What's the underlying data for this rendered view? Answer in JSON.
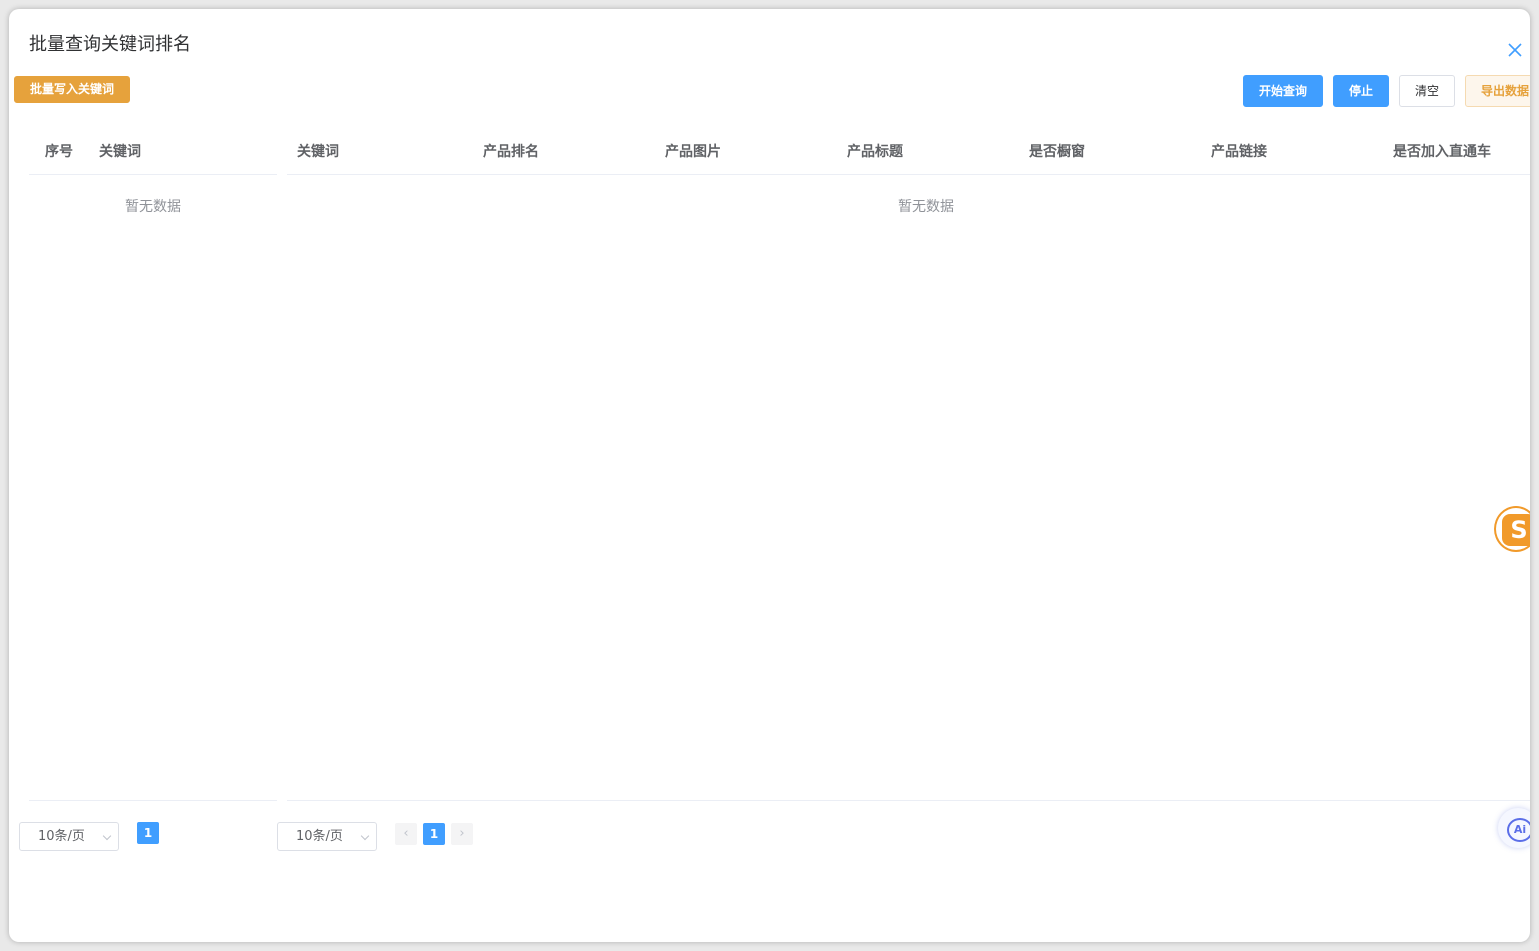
{
  "dialog": {
    "title": "批量查询关键词排名"
  },
  "toolbar": {
    "batch_write_label": "批量写入关键词",
    "start_label": "开始查询",
    "stop_label": "停止",
    "clear_label": "清空",
    "export_label": "导出数据"
  },
  "left_table": {
    "columns": [
      "序号",
      "关键词"
    ],
    "empty_text": "暂无数据",
    "pagination": {
      "page_size": "10条/页",
      "current_page": "1"
    }
  },
  "right_table": {
    "columns": [
      "关键词",
      "产品排名",
      "产品图片",
      "产品标题",
      "是否橱窗",
      "产品链接",
      "是否加入直通车"
    ],
    "empty_text": "暂无数据",
    "pagination": {
      "page_size": "10条/页",
      "prev": "‹",
      "current_page": "1",
      "next": "›"
    }
  },
  "floating": {
    "s_label": "S",
    "ai_label": "Ai"
  },
  "colors": {
    "primary": "#409eff",
    "warning": "#e6a23c"
  }
}
